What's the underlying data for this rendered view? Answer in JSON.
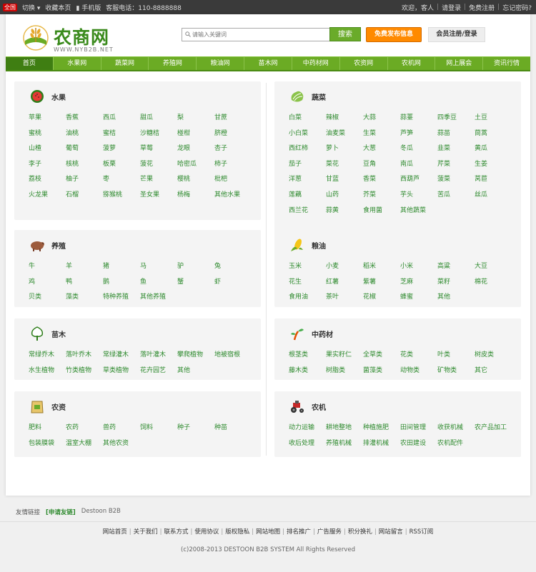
{
  "topbar": {
    "tag": "全国",
    "switch": "切换",
    "bookmark": "收藏本页",
    "mobile": "手机版",
    "hotline": "客服电话：110-8888888",
    "welcome": "欢迎，客人",
    "login": "请登录",
    "register": "免费注册",
    "forgot": "忘记密码?"
  },
  "header": {
    "logo_title": "农商网",
    "logo_sub": "WWW.NYB2B.NET",
    "search_placeholder": "请输入关键词",
    "search_button": "搜索",
    "post_button": "免费发布信息",
    "member_button": "会员注册/登录"
  },
  "nav": [
    "首页",
    "水果网",
    "蔬菜网",
    "养殖网",
    "粮油网",
    "苗木网",
    "中药材网",
    "农资网",
    "农机网",
    "网上展会",
    "资讯行情"
  ],
  "categories": {
    "fruit": {
      "title": "水果",
      "items": [
        "苹果",
        "香蕉",
        "西瓜",
        "甜瓜",
        "梨",
        "甘蔗",
        "蜜桃",
        "油桃",
        "蜜桔",
        "沙糖桔",
        "椪柑",
        "脐橙",
        "山楂",
        "葡萄",
        "菠萝",
        "草莓",
        "龙眼",
        "杏子",
        "李子",
        "核桃",
        "板栗",
        "菠花",
        "哈密瓜",
        "柿子",
        "荔枝",
        "柚子",
        "枣",
        "芒果",
        "樱桃",
        "枇杷",
        "火龙果",
        "石榴",
        "猕猴桃",
        "圣女果",
        "杨梅",
        "其他水果"
      ]
    },
    "vegetable": {
      "title": "蔬菜",
      "items": [
        "白菜",
        "辣椒",
        "大蒜",
        "蒜薹",
        "四季豆",
        "土豆",
        "小白菜",
        "油麦菜",
        "生菜",
        "芦笋",
        "蒜苗",
        "茼蒿",
        "西红柿",
        "萝卜",
        "大葱",
        "冬瓜",
        "韭菜",
        "黄瓜",
        "茄子",
        "菜花",
        "豆角",
        "南瓜",
        "芹菜",
        "生姜",
        "洋葱",
        "甘蓝",
        "香菜",
        "西葫芦",
        "菠菜",
        "莴苣",
        "莲藕",
        "山药",
        "芥菜",
        "芋头",
        "苦瓜",
        "丝瓜",
        "西兰花",
        "蒜黄",
        "食用菌",
        "其他蔬菜"
      ]
    },
    "livestock": {
      "title": "养殖",
      "items": [
        "牛",
        "羊",
        "猪",
        "马",
        "驴",
        "兔",
        "鸡",
        "鸭",
        "鹅",
        "鱼",
        "蟹",
        "虾",
        "贝类",
        "藻类",
        "特种养殖",
        "其他养殖"
      ]
    },
    "grain": {
      "title": "粮油",
      "items": [
        "玉米",
        "小麦",
        "稻米",
        "小米",
        "高粱",
        "大豆",
        "花生",
        "红薯",
        "紫薯",
        "芝麻",
        "菜籽",
        "棉花",
        "食用油",
        "茶叶",
        "花椒",
        "蜂蜜",
        "其他"
      ]
    },
    "nursery": {
      "title": "苗木",
      "items": [
        "常绿乔木",
        "落叶乔木",
        "常绿灌木",
        "落叶灌木",
        "攀爬植物",
        "地被宿根",
        "水生植物",
        "竹类植物",
        "草类植物",
        "花卉园艺",
        "其他"
      ]
    },
    "herb": {
      "title": "中药材",
      "items": [
        "根茎类",
        "果实籽仁",
        "全草类",
        "花类",
        "叶类",
        "树皮类",
        "藤木类",
        "树脂类",
        "菌藻类",
        "动物类",
        "矿物类",
        "其它"
      ]
    },
    "agrisupply": {
      "title": "农资",
      "items": [
        "肥料",
        "农药",
        "兽药",
        "饲料",
        "种子",
        "种苗",
        "包装膜袋",
        "温室大棚",
        "其他农资"
      ]
    },
    "machinery": {
      "title": "农机",
      "items": [
        "动力运输",
        "耕地整地",
        "种植施肥",
        "田间管理",
        "收获机械",
        "农产品加工",
        "收后处理",
        "养殖机械",
        "排灌机械",
        "农田建设",
        "农机配件"
      ]
    }
  },
  "friend": {
    "label": "友情链接",
    "apply": "[申请友链]",
    "link": "Destoon B2B"
  },
  "footer": {
    "links": [
      "网站首页",
      "关于我们",
      "联系方式",
      "使用协议",
      "版权隐私",
      "网站地图",
      "排名推广",
      "广告服务",
      "积分换礼",
      "网站留言",
      "RSS订阅"
    ],
    "copyright": "(c)2008-2013 DESTOON B2B SYSTEM All Rights Reserved"
  },
  "colors": {
    "brand_green": "#6bab24",
    "link_green": "#2e8a2e",
    "orange": "#ff8a00"
  }
}
